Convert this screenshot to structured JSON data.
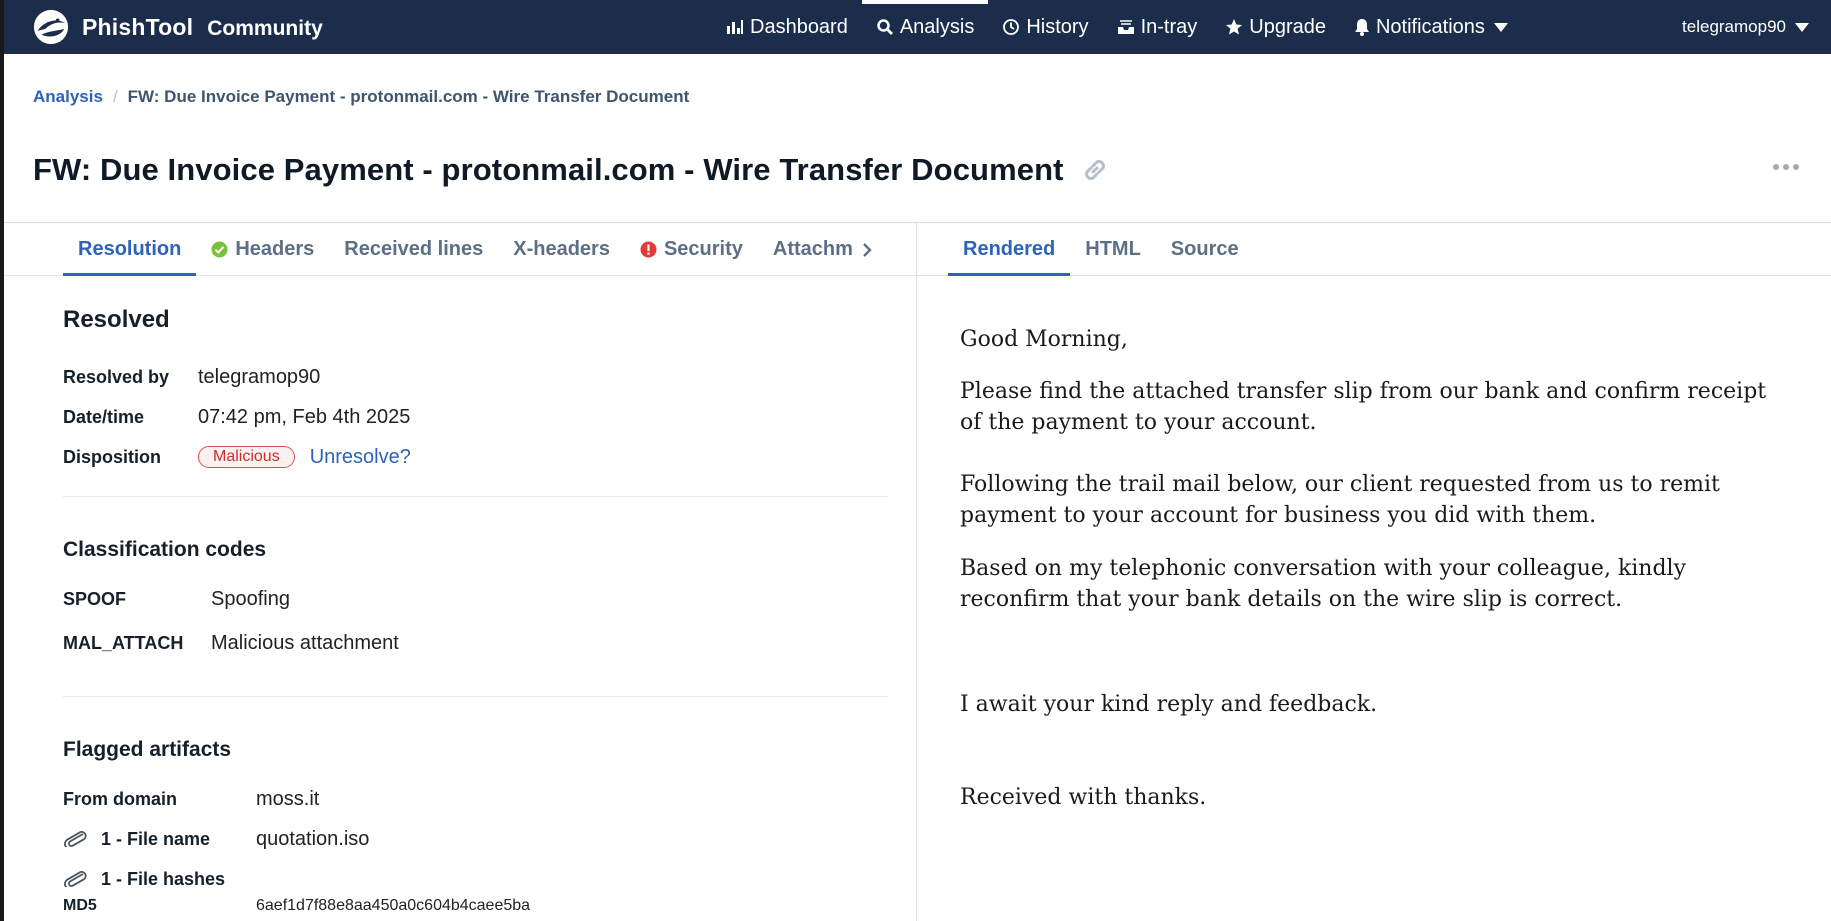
{
  "nav": {
    "brand": "PhishTool",
    "edition": "Community",
    "items": [
      {
        "label": "Dashboard",
        "icon": "bar-chart-icon"
      },
      {
        "label": "Analysis",
        "icon": "search-icon"
      },
      {
        "label": "History",
        "icon": "clock-icon"
      },
      {
        "label": "In-tray",
        "icon": "inbox-icon"
      },
      {
        "label": "Upgrade",
        "icon": "star-icon"
      },
      {
        "label": "Notifications",
        "icon": "bell-icon"
      }
    ],
    "user": "telegramop90"
  },
  "breadcrumb": {
    "root": "Analysis",
    "separator": "/",
    "current": "FW: Due Invoice Payment - protonmail.com - Wire Transfer Document"
  },
  "page_title": "FW: Due Invoice Payment - protonmail.com - Wire Transfer Document",
  "left_tabs": [
    {
      "label": "Resolution"
    },
    {
      "label": "Headers",
      "status": "ok"
    },
    {
      "label": "Received lines"
    },
    {
      "label": "X-headers"
    },
    {
      "label": "Security",
      "status": "alert"
    },
    {
      "label": "Attachm"
    }
  ],
  "right_tabs": [
    {
      "label": "Rendered"
    },
    {
      "label": "HTML"
    },
    {
      "label": "Source"
    }
  ],
  "resolution": {
    "title": "Resolved",
    "resolved_by_label": "Resolved by",
    "resolved_by": "telegramop90",
    "datetime_label": "Date/time",
    "datetime": "07:42 pm, Feb 4th 2025",
    "disposition_label": "Disposition",
    "disposition": "Malicious",
    "unresolve": "Unresolve?"
  },
  "classification": {
    "title": "Classification codes",
    "codes": [
      {
        "code": "SPOOF",
        "desc": "Spoofing"
      },
      {
        "code": "MAL_ATTACH",
        "desc": "Malicious attachment"
      }
    ]
  },
  "artifacts": {
    "title": "Flagged artifacts",
    "from_domain_label": "From domain",
    "from_domain": "moss.it",
    "file_name_label": "1 - File name",
    "file_name": "quotation.iso",
    "file_hashes_label": "1 - File hashes",
    "md5_label": "MD5",
    "md5": "6aef1d7f88e8aa450a0c604b4caee5ba"
  },
  "email": {
    "p1": "Good Morning,",
    "p2": "Please find the attached transfer slip from our bank and confirm receipt of the payment to your account.",
    "p3": "Following the trail mail below, our client requested from us to remit payment to your account for business you did with them.",
    "p4": "Based on my telephonic conversation with your colleague, kindly reconfirm that your bank details on the wire slip is correct.",
    "p5": "I await your kind reply and feedback.",
    "p6": "Received with thanks."
  },
  "colors": {
    "nav_bg": "#1b2d4a",
    "accent": "#2f62b8",
    "ok": "#7ac13f",
    "alert": "#e03b3b",
    "malicious": "#d9534f"
  }
}
